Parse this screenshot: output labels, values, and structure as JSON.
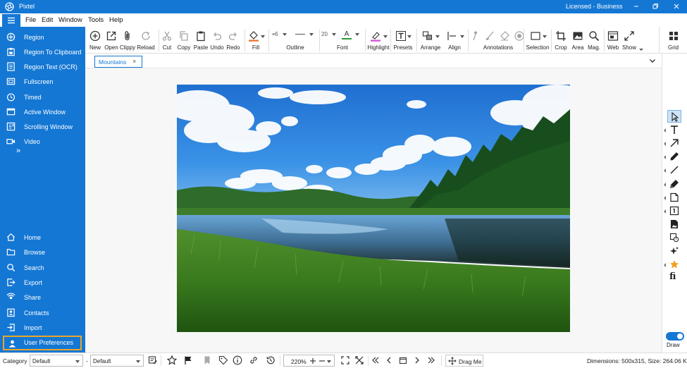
{
  "app": {
    "title": "Pixtel",
    "license": "Licensed - Business"
  },
  "menu": [
    "File",
    "Edit",
    "Window",
    "Tools",
    "Help"
  ],
  "sidebar": {
    "capture_items": [
      {
        "label": "Region",
        "icon": "crosshair-icon"
      },
      {
        "label": "Region To Clipboard",
        "icon": "clipboard-capture-icon"
      },
      {
        "label": "Region Text (OCR)",
        "icon": "ocr-text-icon"
      },
      {
        "label": "Fullscreen",
        "icon": "fullscreen-icon"
      },
      {
        "label": "Timed",
        "icon": "timer-icon"
      },
      {
        "label": "Active Window",
        "icon": "window-icon"
      },
      {
        "label": "Scrolling Window",
        "icon": "scrolling-window-icon"
      },
      {
        "label": "Video",
        "icon": "video-camera-icon"
      }
    ],
    "more_label": "»",
    "nav_items": [
      {
        "label": "Home",
        "icon": "home-icon"
      },
      {
        "label": "Browse",
        "icon": "folder-icon"
      },
      {
        "label": "Search",
        "icon": "search-icon"
      },
      {
        "label": "Export",
        "icon": "export-icon"
      },
      {
        "label": "Share",
        "icon": "share-icon"
      },
      {
        "label": "Contacts",
        "icon": "contacts-icon"
      },
      {
        "label": "Import",
        "icon": "import-icon"
      },
      {
        "label": "User Preferences",
        "icon": "user-icon"
      }
    ]
  },
  "toolbar": {
    "new": "New",
    "open": "Open",
    "clippy": "Clippy",
    "reload": "Reload",
    "cut": "Cut",
    "copy": "Copy",
    "paste": "Paste",
    "undo": "Undo",
    "redo": "Redo",
    "fill": "Fill",
    "outline": "Outline",
    "outline_width": "6",
    "font": "Font",
    "font_size": "20",
    "highlight": "Highlight",
    "presets": "Presets",
    "arrange": "Arrange",
    "align": "Align",
    "annotations": "Annotations",
    "selection": "Selection",
    "crop": "Crop",
    "area": "Area",
    "mag": "Mag.",
    "web": "Web",
    "show": "Show",
    "grid": "Grid"
  },
  "tab": {
    "label": "Mountains",
    "close": "×"
  },
  "right_panel": {
    "tools": [
      "pointer-icon",
      "text-icon",
      "arrow-icon",
      "pen-icon",
      "line-icon",
      "marker-icon",
      "note-icon",
      "step-number-icon",
      "image-file-icon",
      "stamp-icon",
      "sparkle-icon",
      "star-icon",
      "ligature-fi-icon"
    ],
    "fi_text": "fi",
    "draw_label": "Draw",
    "draw_enabled": true
  },
  "statusbar": {
    "category_label": "Category",
    "category_value": "Default",
    "dash": "-",
    "preset_value": "Default",
    "zoom": "220%",
    "drag_me": "Drag Me",
    "dimensions": "Dimensions: 500x315, Size: 264.06 KB"
  },
  "colors": {
    "brand": "#1477d4",
    "selected_border": "#e8a528",
    "fill_swatch": "#e8742a",
    "font_swatch": "#2a9a3a",
    "highlight_swatch": "#d64fd6"
  }
}
